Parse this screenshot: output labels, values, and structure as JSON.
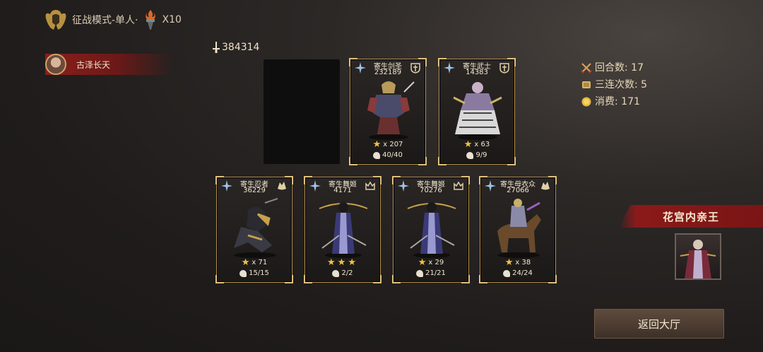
{
  "header": {
    "mode_label": "征战模式-单人·",
    "multiplier": "X10"
  },
  "player": {
    "name": "古泽长天"
  },
  "team_power": "384314",
  "stats": {
    "rounds": "回合数: 17",
    "combo": "三连次数: 5",
    "cost": "消费: 171"
  },
  "cards_top": [
    {
      "name": "寄生剑圣",
      "power": "232189",
      "stars": "x 207",
      "count": "40/40"
    },
    {
      "name": "寄生武士",
      "power": "14383",
      "stars": "x 63",
      "count": "9/9"
    }
  ],
  "cards_bottom": [
    {
      "name": "寄生忍者",
      "power": "36229",
      "stars": "x 71",
      "count": "15/15"
    },
    {
      "name": "寄生舞姬",
      "power": "4171",
      "stars": "",
      "count": "2/2"
    },
    {
      "name": "寄生舞姬",
      "power": "70276",
      "stars": "x 29",
      "count": "21/21"
    },
    {
      "name": "寄生母衣众",
      "power": "27066",
      "stars": "x 38",
      "count": "24/24"
    }
  ],
  "boss": {
    "name": "花宫内亲王"
  },
  "back_button": "返回大厅",
  "colors": {
    "gold": "#c9a46a",
    "red_banner": "#8b1a1a",
    "star": "#f6c23e"
  }
}
